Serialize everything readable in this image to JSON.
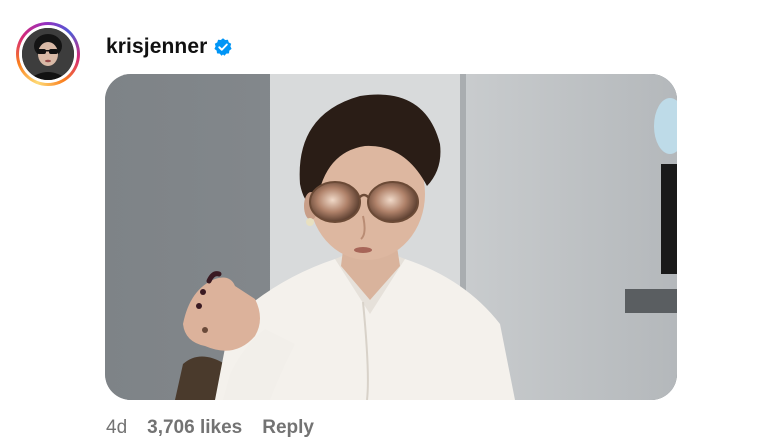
{
  "comment": {
    "username": "krisjenner",
    "verified": true,
    "verified_color": "#0095f6",
    "avatar": {
      "icon": "profile-photo",
      "story_ring": true
    },
    "media": {
      "type": "gif",
      "icon": "gif-image"
    },
    "meta": {
      "time": "4d",
      "likes": "3,706 likes",
      "reply_label": "Reply"
    }
  }
}
